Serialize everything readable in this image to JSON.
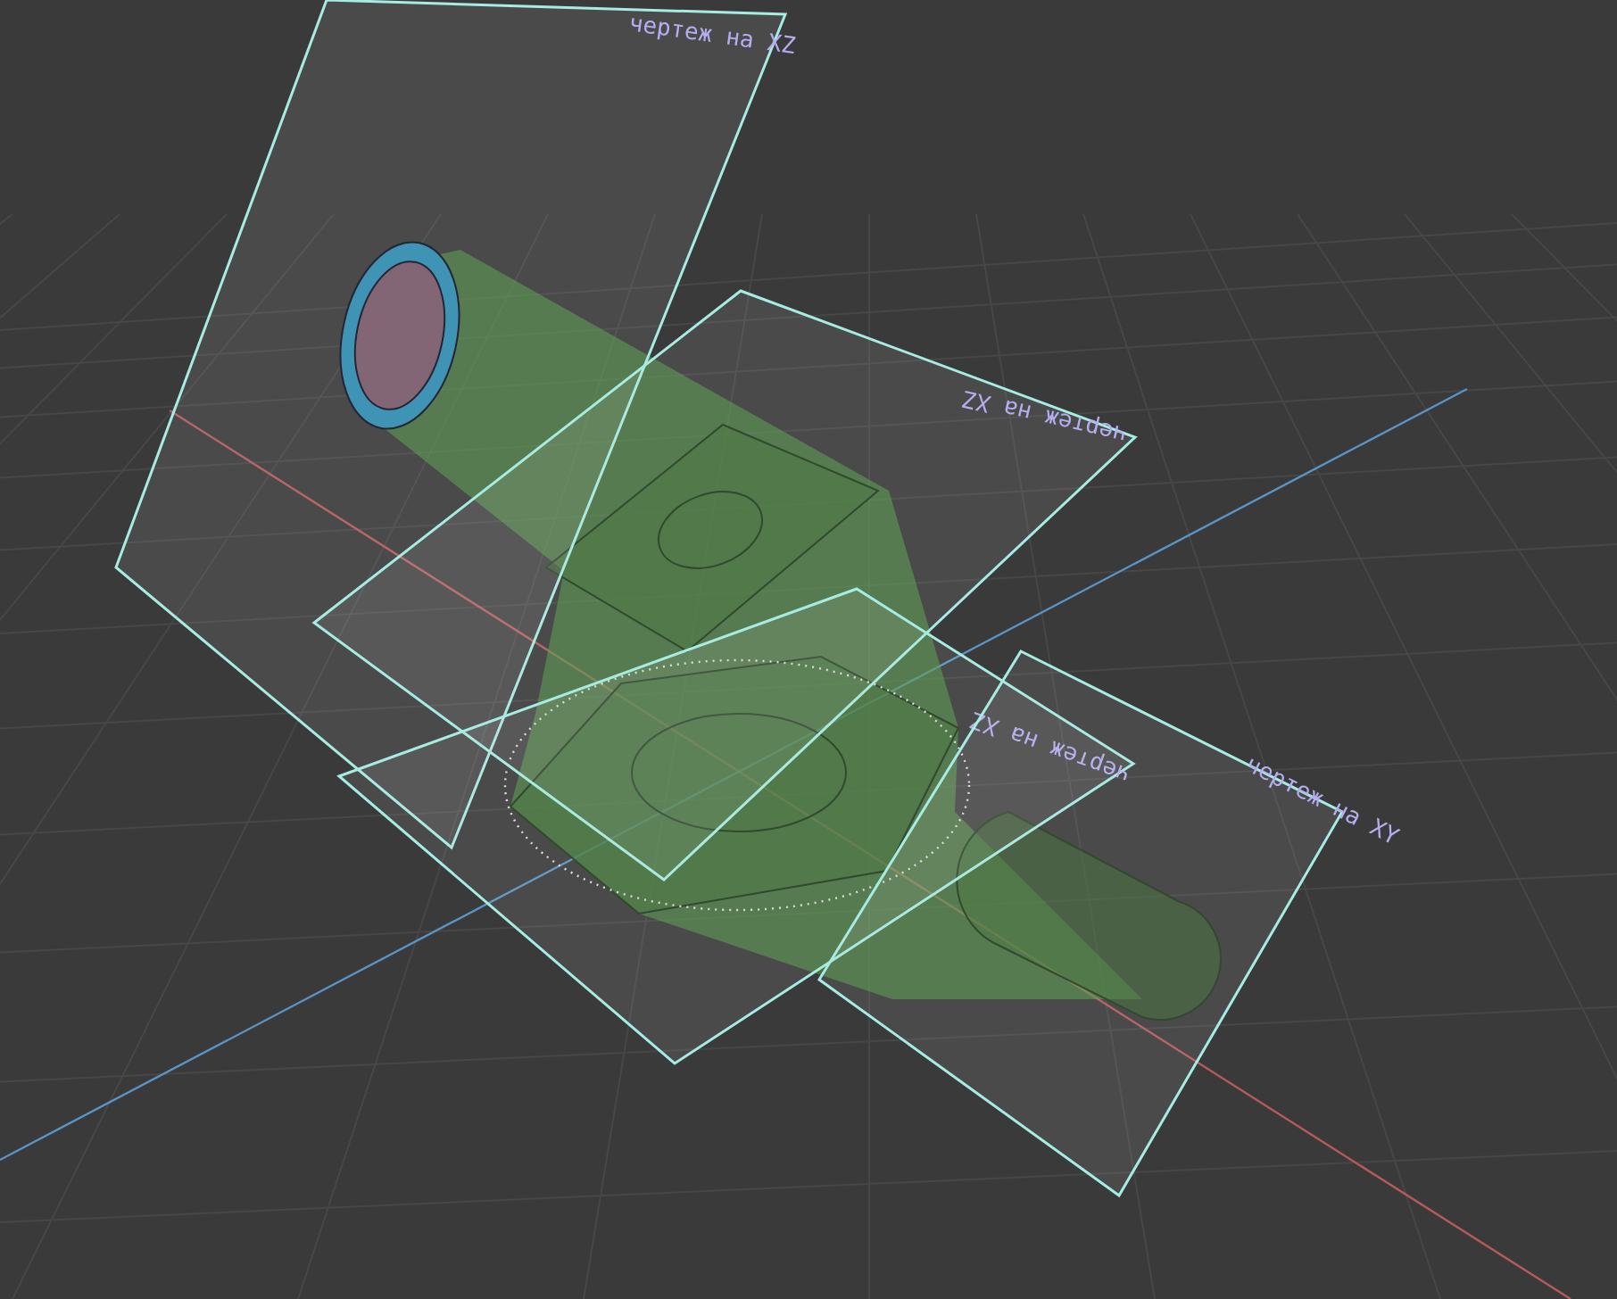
{
  "viewport": {
    "planes": [
      {
        "label": "чертеж на XZ"
      },
      {
        "label": "чертеж на XZ"
      },
      {
        "label": "чертеж на XZ"
      },
      {
        "label": "чертеж на XY"
      }
    ]
  }
}
